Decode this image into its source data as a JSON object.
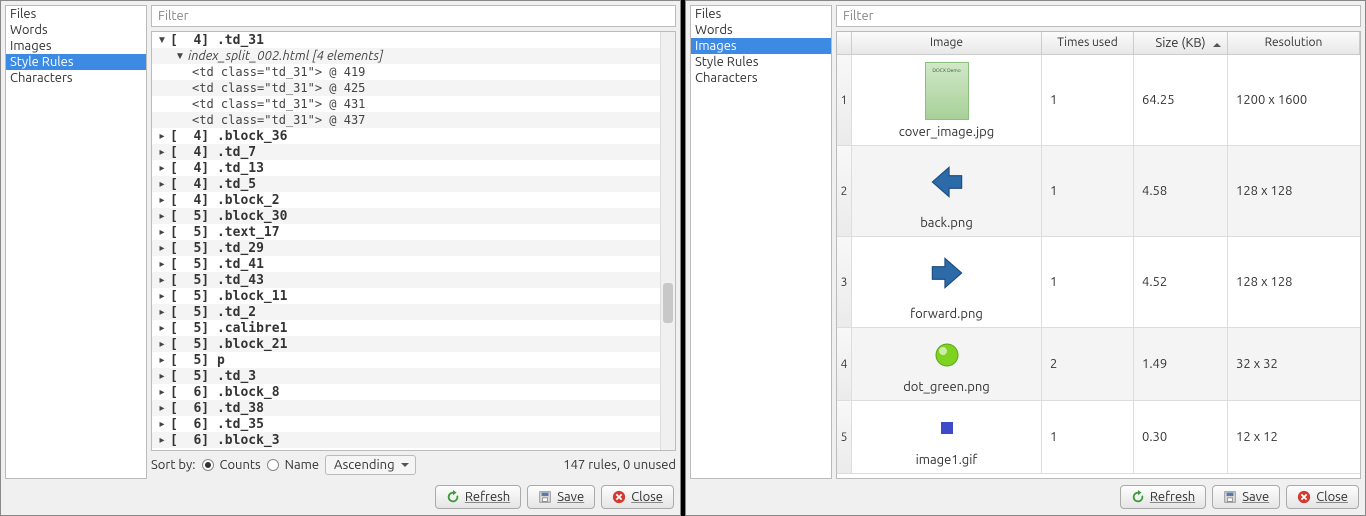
{
  "left": {
    "sidebar": [
      "Files",
      "Words",
      "Images",
      "Style Rules",
      "Characters"
    ],
    "selected": "Style Rules",
    "filter_placeholder": "Filter",
    "expanded": {
      "count": 4,
      "name": ".td_31",
      "file": "index_split_002.html",
      "elements_label": "[4 elements]",
      "matches": [
        "<td class=\"td_31\"> @ 419",
        "<td class=\"td_31\"> @ 425",
        "<td class=\"td_31\"> @ 431",
        "<td class=\"td_31\"> @ 437"
      ]
    },
    "rules": [
      {
        "count": 4,
        "name": ".block_36"
      },
      {
        "count": 4,
        "name": ".td_7"
      },
      {
        "count": 4,
        "name": ".td_13"
      },
      {
        "count": 4,
        "name": ".td_5"
      },
      {
        "count": 4,
        "name": ".block_2"
      },
      {
        "count": 5,
        "name": ".block_30"
      },
      {
        "count": 5,
        "name": ".text_17"
      },
      {
        "count": 5,
        "name": ".td_29"
      },
      {
        "count": 5,
        "name": ".td_41"
      },
      {
        "count": 5,
        "name": ".td_43"
      },
      {
        "count": 5,
        "name": ".block_11"
      },
      {
        "count": 5,
        "name": ".td_2"
      },
      {
        "count": 5,
        "name": ".calibre1"
      },
      {
        "count": 5,
        "name": ".block_21"
      },
      {
        "count": 5,
        "name": "p"
      },
      {
        "count": 5,
        "name": ".td_3"
      },
      {
        "count": 6,
        "name": ".block_8"
      },
      {
        "count": 6,
        "name": ".td_38"
      },
      {
        "count": 6,
        "name": ".td_35"
      },
      {
        "count": 6,
        "name": ".block_3"
      }
    ],
    "sort_label": "Sort by:",
    "radio_counts": "Counts",
    "radio_name": "Name",
    "order": "Ascending",
    "status": "147 rules, 0 unused",
    "buttons": {
      "refresh": "Refresh",
      "save": "Save",
      "close": "Close"
    }
  },
  "right": {
    "sidebar": [
      "Files",
      "Words",
      "Images",
      "Style Rules",
      "Characters"
    ],
    "selected": "Images",
    "filter_placeholder": "Filter",
    "columns": {
      "image": "Image",
      "times": "Times used",
      "size": "Size (KB)",
      "res": "Resolution"
    },
    "rows": [
      {
        "n": 1,
        "name": "cover_image.jpg",
        "times": 1,
        "size": "64.25",
        "res": "1200 x 1600",
        "thumb": "cover"
      },
      {
        "n": 2,
        "name": "back.png",
        "times": 1,
        "size": "4.58",
        "res": "128 x 128",
        "thumb": "back"
      },
      {
        "n": 3,
        "name": "forward.png",
        "times": 1,
        "size": "4.52",
        "res": "128 x 128",
        "thumb": "forward"
      },
      {
        "n": 4,
        "name": "dot_green.png",
        "times": 2,
        "size": "1.49",
        "res": "32 x 32",
        "thumb": "dot"
      },
      {
        "n": 5,
        "name": "image1.gif",
        "times": 1,
        "size": "0.30",
        "res": "12 x 12",
        "thumb": "px"
      }
    ],
    "buttons": {
      "refresh": "Refresh",
      "save": "Save",
      "close": "Close"
    }
  }
}
